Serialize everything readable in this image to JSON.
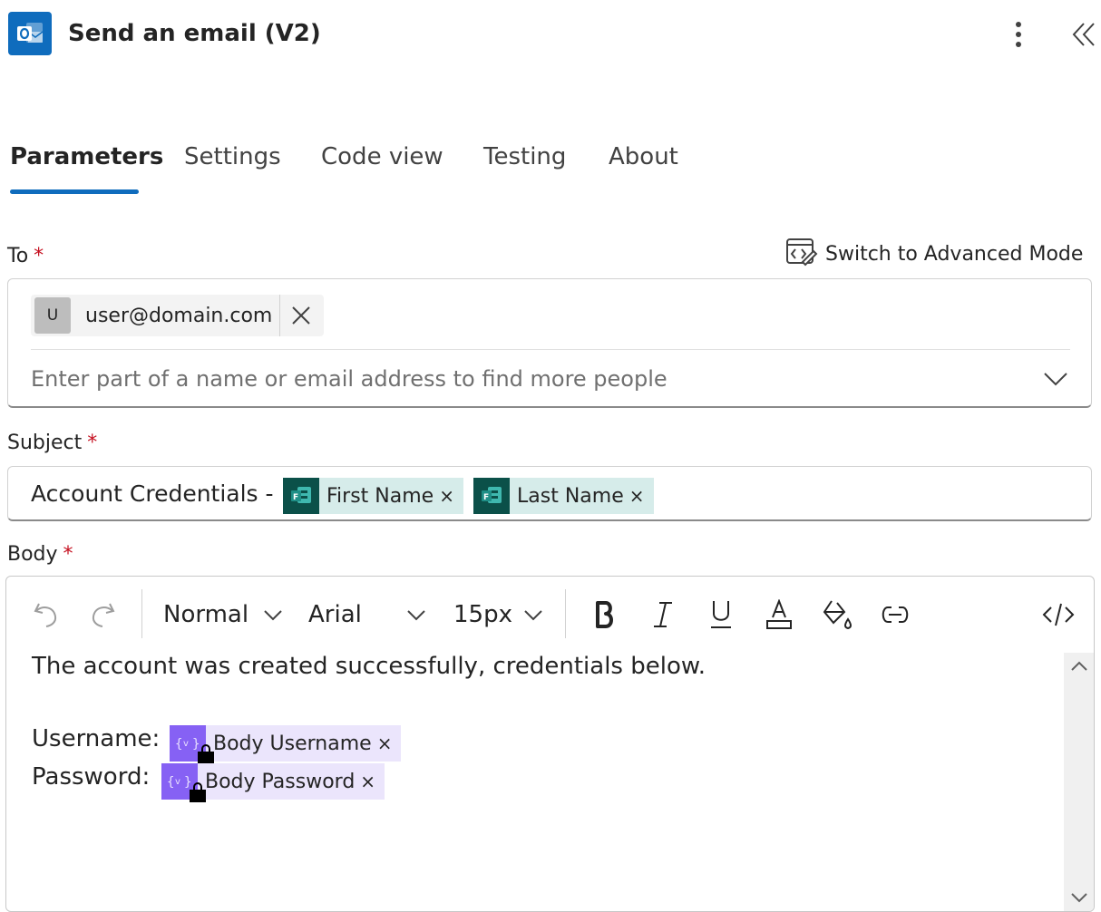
{
  "header": {
    "title": "Send an email (V2)",
    "app_icon": "outlook-icon",
    "more_icon": "more-vertical-icon",
    "collapse_icon": "double-chevron-left-icon"
  },
  "tabs": [
    {
      "label": "Parameters",
      "active": true
    },
    {
      "label": "Settings",
      "active": false
    },
    {
      "label": "Code view",
      "active": false
    },
    {
      "label": "Testing",
      "active": false
    },
    {
      "label": "About",
      "active": false
    }
  ],
  "to": {
    "label": "To",
    "required": "*",
    "advanced_mode_label": "Switch to Advanced Mode",
    "recipient_initial": "U",
    "recipient_email": "user@domain.com",
    "placeholder": "Enter part of a name or email address to find more people"
  },
  "subject": {
    "label": "Subject",
    "required": "*",
    "text": "Account Credentials -",
    "tokens": [
      {
        "label": "First Name",
        "remove": "×",
        "icon": "microsoft-forms-icon"
      },
      {
        "label": "Last Name",
        "remove": "×",
        "icon": "microsoft-forms-icon"
      }
    ]
  },
  "body": {
    "label": "Body",
    "required": "*",
    "toolbar": {
      "format": "Normal",
      "font": "Arial",
      "size": "15px"
    },
    "line1": "The account was created successfully, credentials below.",
    "username_label": "Username:",
    "password_label": "Password:",
    "tokens": [
      {
        "label": "Body Username",
        "remove": "×",
        "icon": "variable-icon"
      },
      {
        "label": "Body Password",
        "remove": "×",
        "icon": "variable-icon"
      }
    ]
  },
  "colors": {
    "accent": "#0f6cbd",
    "required": "#c50f1f",
    "forms_token_bg": "#d6ecea",
    "variable_token_bg": "#ebe5fc",
    "variable_icon_bg": "#8661f4"
  }
}
